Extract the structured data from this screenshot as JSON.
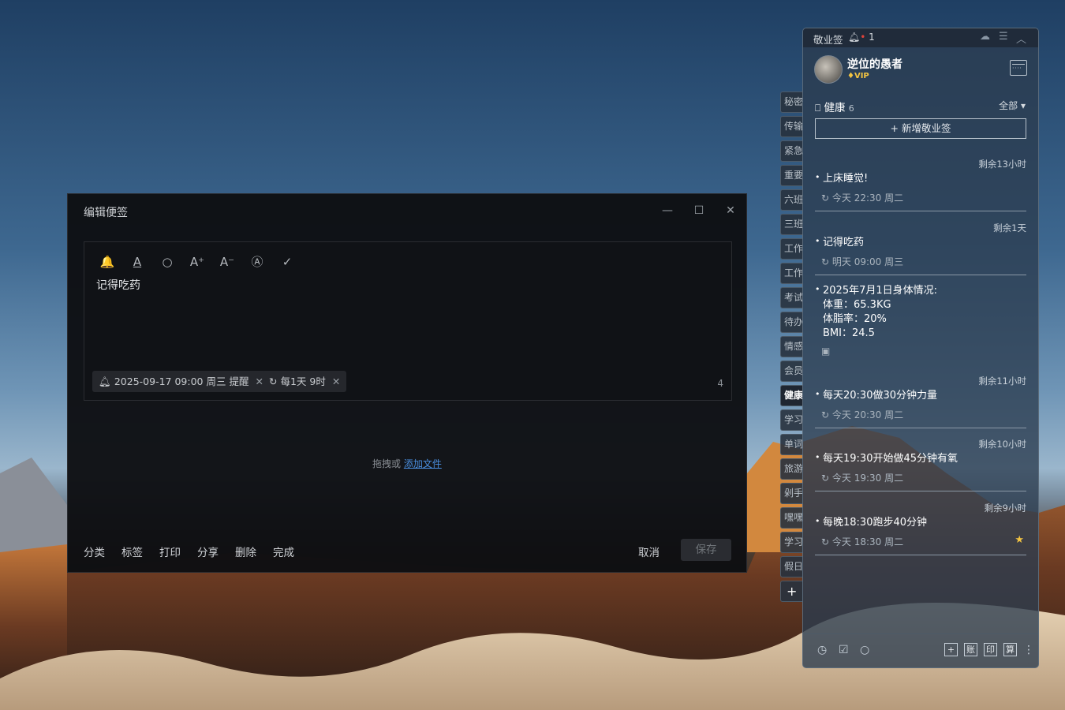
{
  "editor": {
    "title": "编辑便签",
    "window_buttons": {
      "minimize": "—",
      "maximize": "☐",
      "close": "✕"
    },
    "toolbar": {
      "reminder": "🔔",
      "font_color": "A",
      "search": "○",
      "font_up": "A⁺",
      "font_down": "A⁻",
      "format": "Ⓐ",
      "done": "✓"
    },
    "note_text": "记得吃药",
    "reminder_chip": "2025-09-17 09:00 周三 提醒",
    "repeat_chip": "每1天 9时",
    "char_count": "4",
    "drop_prefix": "拖拽或 ",
    "drop_link": "添加文件",
    "footer": [
      "分类",
      "标签",
      "打印",
      "分享",
      "删除",
      "完成"
    ],
    "cancel_label": "取消",
    "save_label": "保存"
  },
  "side_tabs": [
    "秘密",
    "传输",
    "紧急",
    "重要",
    "六班",
    "三班",
    "工作",
    "工作",
    "考试",
    "待办",
    "情感",
    "会员",
    "健康",
    "学习",
    "单词",
    "旅游",
    "剁手",
    "嘿嘿",
    "学习",
    "假日"
  ],
  "active_tab": "健康",
  "add_tab": "+",
  "panel": {
    "title": "敬业签",
    "bell_count": "1",
    "user_name": "逆位的愚者",
    "vip": "VIP",
    "category": "健康",
    "category_count": "6",
    "filter": "全部 ▾",
    "new_note": "+ 新增敬业签",
    "notes": [
      {
        "remain": "剩余13小时",
        "title": "上床睡觉!",
        "time": "今天 22:30 周二"
      },
      {
        "remain": "剩余1天",
        "title": "记得吃药",
        "time": "明天 09:00 周三"
      },
      {
        "remain": "",
        "lines": [
          "2025年7月1日身体情况:",
          "体重：65.3KG",
          "体脂率：20%",
          "BMI：24.5"
        ],
        "time": ""
      },
      {
        "remain": "剩余11小时",
        "title": "每天20:30做30分钟力量",
        "time": "今天 20:30 周二"
      },
      {
        "remain": "剩余10小时",
        "title": "每天19:30开始做45分钟有氧",
        "time": "今天 19:30 周二"
      },
      {
        "remain": "剩余9小时",
        "title": "每晚18:30跑步40分钟",
        "time": "今天 18:30 周二"
      }
    ],
    "bottom_boxes": [
      "+",
      "账",
      "印",
      "算"
    ]
  }
}
